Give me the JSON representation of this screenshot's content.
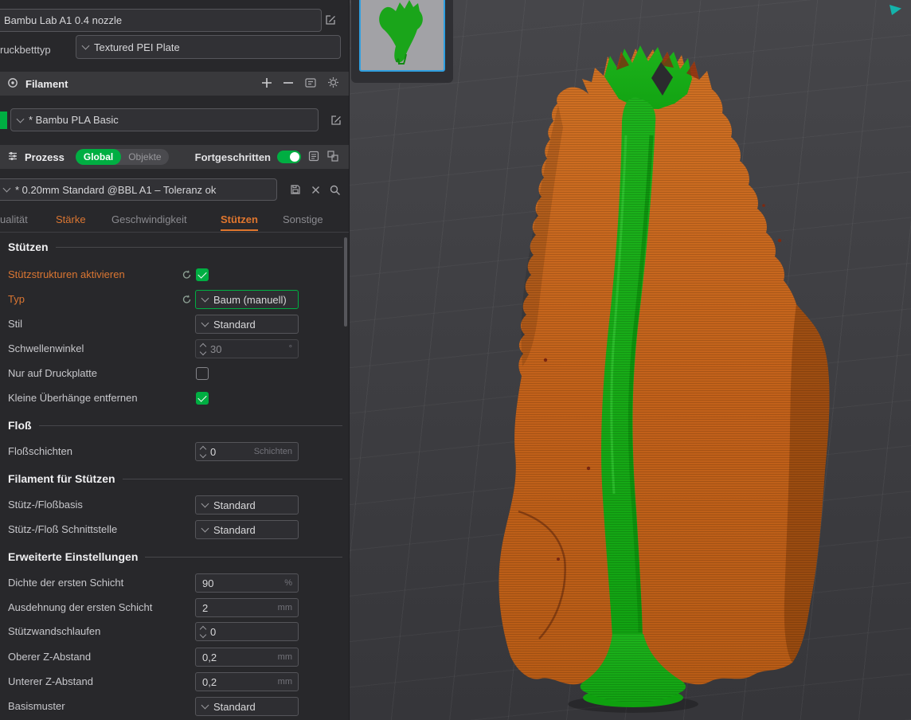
{
  "printer": {
    "name": "Bambu Lab A1 0.4 nozzle",
    "bed_type_label": "ruckbetttyp",
    "bed_type_value": "Textured PEI Plate"
  },
  "filament": {
    "header_title": "Filament",
    "selected": "* Bambu PLA Basic",
    "color": "#00ae42"
  },
  "process": {
    "header_title": "Prozess",
    "scope_global": "Global",
    "scope_objects": "Objekte",
    "advanced_label": "Fortgeschritten",
    "preset": "* 0.20mm Standard @BBL A1 – Toleranz ok"
  },
  "tabs": {
    "quality": "ualität",
    "strength": "Stärke",
    "speed": "Geschwindigkeit",
    "support": "Stützen",
    "others": "Sonstige"
  },
  "support_section": {
    "title": "Stützen",
    "enable_label": "Stützstrukturen aktivieren",
    "type_label": "Typ",
    "type_value": "Baum (manuell)",
    "style_label": "Stil",
    "style_value": "Standard",
    "threshold_label": "Schwellenwinkel",
    "threshold_value": "30",
    "threshold_unit": "°",
    "on_plate_label": "Nur auf Druckplatte",
    "small_overhangs_label": "Kleine Überhänge entfernen"
  },
  "raft_section": {
    "title": "Floß",
    "layers_label": "Floßschichten",
    "layers_value": "0",
    "layers_unit": "Schichten"
  },
  "support_filament_section": {
    "title": "Filament für Stützen",
    "base_label": "Stütz-/Floßbasis",
    "base_value": "Standard",
    "interface_label": "Stütz-/Floß Schnittstelle",
    "interface_value": "Standard"
  },
  "advanced_section": {
    "title": "Erweiterte Einstellungen",
    "first_layer_density_label": "Dichte der ersten Schicht",
    "first_layer_density_value": "90",
    "first_layer_density_unit": "%",
    "first_layer_expansion_label": "Ausdehnung der ersten Schicht",
    "first_layer_expansion_value": "2",
    "first_layer_expansion_unit": "mm",
    "wall_loops_label": "Stützwandschlaufen",
    "wall_loops_value": "0",
    "top_z_label": "Oberer Z-Abstand",
    "top_z_value": "0,2",
    "top_z_unit": "mm",
    "bottom_z_label": "Unterer Z-Abstand",
    "bottom_z_value": "0,2",
    "bottom_z_unit": "mm",
    "base_pattern_label": "Basismuster",
    "base_pattern_value": "Standard"
  },
  "viewport": {
    "model_color": "#c2661c",
    "support_color": "#15b115",
    "selection_color": "#2f9fe0"
  }
}
